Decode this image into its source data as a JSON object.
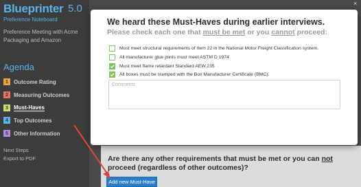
{
  "app": {
    "name": "Blueprinter",
    "version": "5.0",
    "subtitle": "Preference Noteboard"
  },
  "meeting": {
    "description": "Preference Meeting with Acme Packaging and Amazon"
  },
  "agenda": {
    "title": "Agenda",
    "items": [
      {
        "num": "1",
        "label": "Outcome Rating",
        "color": "#f0a33c"
      },
      {
        "num": "2",
        "label": "Measuring Outcomes",
        "color": "#e8746c"
      },
      {
        "num": "3",
        "label": "Must-Haves",
        "color": "#c9e06b"
      },
      {
        "num": "4",
        "label": "Top Outcomes",
        "color": "#59b3e6"
      },
      {
        "num": "5",
        "label": "Other Information",
        "color": "#b48be0"
      }
    ]
  },
  "footer_links": {
    "next_steps": "Next Steps",
    "export": "Export to PDF"
  },
  "modal": {
    "title": "We heard these Must-Haves during earlier interviews.",
    "subtitle_pre": "Please check each one that ",
    "subtitle_u1": "must be met",
    "subtitle_mid": " or you ",
    "subtitle_u2": "cannot",
    "subtitle_post": " proceed:",
    "close": "×",
    "items": [
      {
        "label": "Must meet structural requirements of Item 22 in the National Motor Freight Classification system.",
        "checked": false
      },
      {
        "label": "All manufacturer glue joints must meet ASTM D 1974",
        "checked": false
      },
      {
        "label": "Must meet flame retardant Standard AEW.235",
        "checked": true
      },
      {
        "label": "All boxes must be stamped with the Box Manufacturer Certificate (BMC).",
        "checked": true
      }
    ],
    "comments_placeholder": "Comments"
  },
  "question": {
    "part1": "Are there any other requirements that must be met or you can ",
    "underline": "not",
    "part2": " proceed (regardless of other outcomes)?"
  },
  "add_button": "Add new Must-Have",
  "colors": {
    "accent": "#59b3e6",
    "check": "#7cc35a",
    "button": "#2a7ec9",
    "arrow": "#e0473b"
  }
}
